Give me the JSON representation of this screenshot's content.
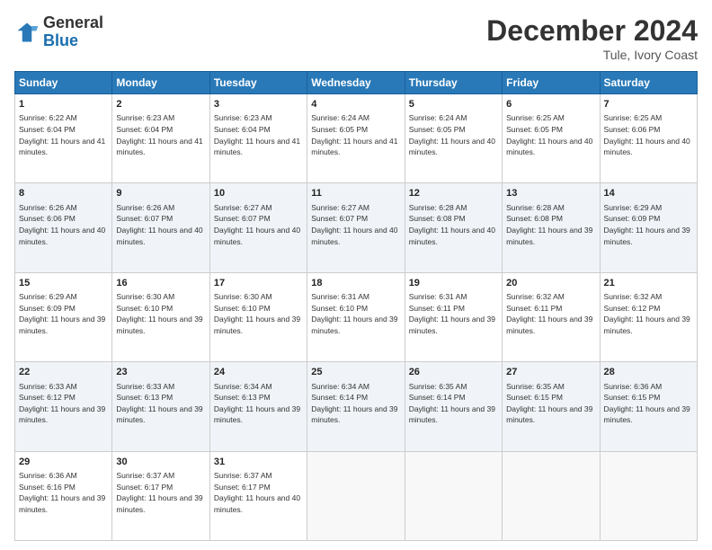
{
  "logo": {
    "line1": "General",
    "line2": "Blue"
  },
  "title": "December 2024",
  "location": "Tule, Ivory Coast",
  "days_header": [
    "Sunday",
    "Monday",
    "Tuesday",
    "Wednesday",
    "Thursday",
    "Friday",
    "Saturday"
  ],
  "weeks": [
    [
      {
        "day": "1",
        "sunrise": "6:22 AM",
        "sunset": "6:04 PM",
        "daylight": "11 hours and 41 minutes."
      },
      {
        "day": "2",
        "sunrise": "6:23 AM",
        "sunset": "6:04 PM",
        "daylight": "11 hours and 41 minutes."
      },
      {
        "day": "3",
        "sunrise": "6:23 AM",
        "sunset": "6:04 PM",
        "daylight": "11 hours and 41 minutes."
      },
      {
        "day": "4",
        "sunrise": "6:24 AM",
        "sunset": "6:05 PM",
        "daylight": "11 hours and 41 minutes."
      },
      {
        "day": "5",
        "sunrise": "6:24 AM",
        "sunset": "6:05 PM",
        "daylight": "11 hours and 40 minutes."
      },
      {
        "day": "6",
        "sunrise": "6:25 AM",
        "sunset": "6:05 PM",
        "daylight": "11 hours and 40 minutes."
      },
      {
        "day": "7",
        "sunrise": "6:25 AM",
        "sunset": "6:06 PM",
        "daylight": "11 hours and 40 minutes."
      }
    ],
    [
      {
        "day": "8",
        "sunrise": "6:26 AM",
        "sunset": "6:06 PM",
        "daylight": "11 hours and 40 minutes."
      },
      {
        "day": "9",
        "sunrise": "6:26 AM",
        "sunset": "6:07 PM",
        "daylight": "11 hours and 40 minutes."
      },
      {
        "day": "10",
        "sunrise": "6:27 AM",
        "sunset": "6:07 PM",
        "daylight": "11 hours and 40 minutes."
      },
      {
        "day": "11",
        "sunrise": "6:27 AM",
        "sunset": "6:07 PM",
        "daylight": "11 hours and 40 minutes."
      },
      {
        "day": "12",
        "sunrise": "6:28 AM",
        "sunset": "6:08 PM",
        "daylight": "11 hours and 40 minutes."
      },
      {
        "day": "13",
        "sunrise": "6:28 AM",
        "sunset": "6:08 PM",
        "daylight": "11 hours and 39 minutes."
      },
      {
        "day": "14",
        "sunrise": "6:29 AM",
        "sunset": "6:09 PM",
        "daylight": "11 hours and 39 minutes."
      }
    ],
    [
      {
        "day": "15",
        "sunrise": "6:29 AM",
        "sunset": "6:09 PM",
        "daylight": "11 hours and 39 minutes."
      },
      {
        "day": "16",
        "sunrise": "6:30 AM",
        "sunset": "6:10 PM",
        "daylight": "11 hours and 39 minutes."
      },
      {
        "day": "17",
        "sunrise": "6:30 AM",
        "sunset": "6:10 PM",
        "daylight": "11 hours and 39 minutes."
      },
      {
        "day": "18",
        "sunrise": "6:31 AM",
        "sunset": "6:10 PM",
        "daylight": "11 hours and 39 minutes."
      },
      {
        "day": "19",
        "sunrise": "6:31 AM",
        "sunset": "6:11 PM",
        "daylight": "11 hours and 39 minutes."
      },
      {
        "day": "20",
        "sunrise": "6:32 AM",
        "sunset": "6:11 PM",
        "daylight": "11 hours and 39 minutes."
      },
      {
        "day": "21",
        "sunrise": "6:32 AM",
        "sunset": "6:12 PM",
        "daylight": "11 hours and 39 minutes."
      }
    ],
    [
      {
        "day": "22",
        "sunrise": "6:33 AM",
        "sunset": "6:12 PM",
        "daylight": "11 hours and 39 minutes."
      },
      {
        "day": "23",
        "sunrise": "6:33 AM",
        "sunset": "6:13 PM",
        "daylight": "11 hours and 39 minutes."
      },
      {
        "day": "24",
        "sunrise": "6:34 AM",
        "sunset": "6:13 PM",
        "daylight": "11 hours and 39 minutes."
      },
      {
        "day": "25",
        "sunrise": "6:34 AM",
        "sunset": "6:14 PM",
        "daylight": "11 hours and 39 minutes."
      },
      {
        "day": "26",
        "sunrise": "6:35 AM",
        "sunset": "6:14 PM",
        "daylight": "11 hours and 39 minutes."
      },
      {
        "day": "27",
        "sunrise": "6:35 AM",
        "sunset": "6:15 PM",
        "daylight": "11 hours and 39 minutes."
      },
      {
        "day": "28",
        "sunrise": "6:36 AM",
        "sunset": "6:15 PM",
        "daylight": "11 hours and 39 minutes."
      }
    ],
    [
      {
        "day": "29",
        "sunrise": "6:36 AM",
        "sunset": "6:16 PM",
        "daylight": "11 hours and 39 minutes."
      },
      {
        "day": "30",
        "sunrise": "6:37 AM",
        "sunset": "6:17 PM",
        "daylight": "11 hours and 39 minutes."
      },
      {
        "day": "31",
        "sunrise": "6:37 AM",
        "sunset": "6:17 PM",
        "daylight": "11 hours and 40 minutes."
      },
      null,
      null,
      null,
      null
    ]
  ]
}
